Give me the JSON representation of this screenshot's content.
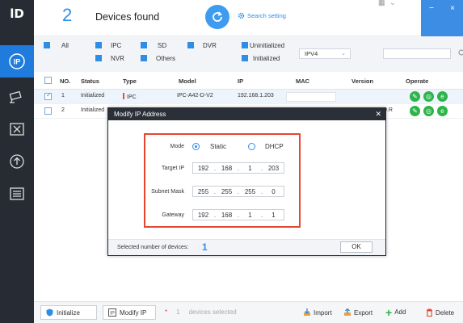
{
  "app": {
    "logo_text": "lD"
  },
  "header": {
    "device_count": "2",
    "devices_found_label": "Devices found",
    "search_setting_label": "Search setting"
  },
  "filters": {
    "all": "All",
    "ipc": "IPC",
    "sd": "SD",
    "dvr": "DVR",
    "nvr": "NVR",
    "others": "Others",
    "uninitialized": "Uninitialized",
    "initialized": "Initialized",
    "ip_version": "IPV4",
    "search_value": ""
  },
  "table": {
    "headers": [
      "NO.",
      "Status",
      "Type",
      "Model",
      "IP",
      "MAC",
      "Version",
      "Operate"
    ],
    "rows": [
      {
        "no": "1",
        "status": "Initialized",
        "type": "IPC",
        "model": "IPC-A42-D-V2",
        "ip": "192.168.1.203",
        "mac": "",
        "version": "",
        "checked": true
      },
      {
        "no": "2",
        "status": "Initialized",
        "type": "",
        "model": "",
        "ip": "",
        "mac": "",
        "version": "0.R",
        "checked": false
      }
    ]
  },
  "modal": {
    "title": "Modify IP Address",
    "mode_label": "Mode",
    "static_label": "Static",
    "dhcp_label": "DHCP",
    "mode_selected": "Static",
    "target_ip_label": "Target IP",
    "target_ip": [
      "192",
      "168",
      "1",
      "203"
    ],
    "subnet_mask_label": "Subnet Mask",
    "subnet_mask": [
      "255",
      "255",
      "255",
      "0"
    ],
    "gateway_label": "Gateway",
    "gateway": [
      "192",
      "168",
      "1",
      "1"
    ],
    "selected_label": "Selected number of devices:",
    "selected_count": "1",
    "ok_label": "OK"
  },
  "bottombar": {
    "initialize_label": "Initialize",
    "modify_ip_label": "Modify IP",
    "selected_star": "*",
    "selected_count": "1",
    "devices_selected_label": "devices selected",
    "import_label": "Import",
    "export_label": "Export",
    "add_label": "Add",
    "delete_label": "Delete"
  },
  "colors": {
    "accent": "#2f8de4",
    "sidebar": "#272b33",
    "highlight_box": "#e5472f",
    "operate_green": "#2db44a"
  }
}
